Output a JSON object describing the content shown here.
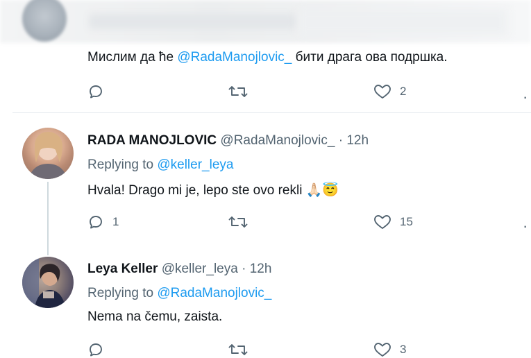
{
  "top_tweet": {
    "text_prefix": "Мислим да ће ",
    "mention": "@RadaManojlovic_",
    "text_suffix": " бити драга ова подршка.",
    "reply_count": "",
    "retweet_count": "",
    "like_count": "2"
  },
  "tweet_rada": {
    "display_name": "RADA MANOJLOVIC",
    "handle": "@RadaManojlovic_",
    "separator": "·",
    "time": "12h",
    "replying_label": "Replying to",
    "replying_to": "@keller_leya",
    "text": "Hvala! Drago mi je, lepo ste ovo rekli ",
    "emoji": "🙏🏻😇",
    "reply_count": "1",
    "retweet_count": "",
    "like_count": "15"
  },
  "tweet_leya": {
    "display_name": "Leya Keller",
    "handle": "@keller_leya",
    "separator": "·",
    "time": "12h",
    "replying_label": "Replying to",
    "replying_to": "@RadaManojlovic_",
    "text": "Nema na čemu, zaista.",
    "reply_count": "",
    "retweet_count": "",
    "like_count": "3"
  },
  "icons": {
    "reply": "reply-icon",
    "retweet": "retweet-icon",
    "like": "heart-icon",
    "more": "more-icon"
  },
  "colors": {
    "mention": "#1d9bf0",
    "secondary": "#536471",
    "text": "#0f1419"
  }
}
